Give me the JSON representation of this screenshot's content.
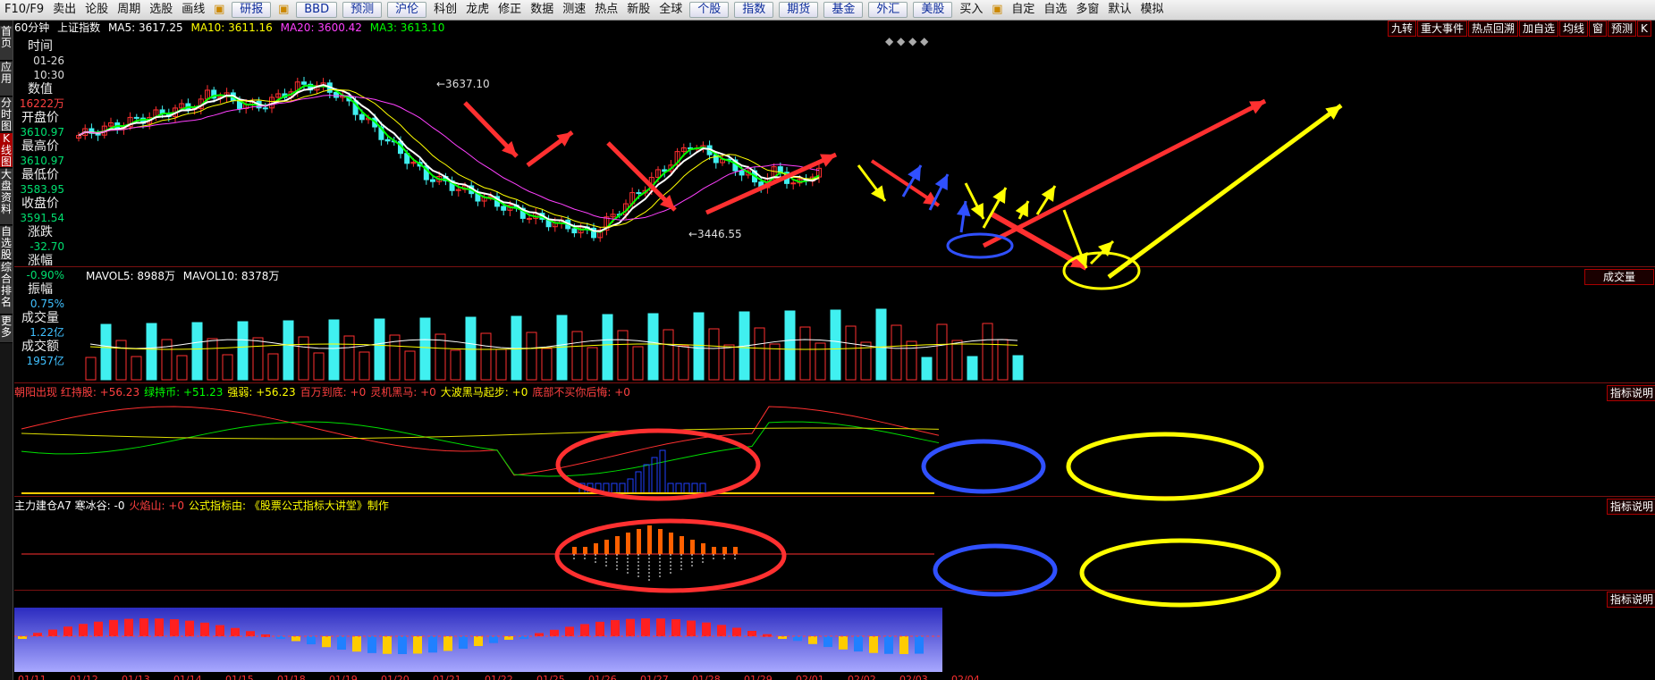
{
  "toolbar": {
    "items": [
      "F10/F9",
      "卖出",
      "论股",
      "周期",
      "选股",
      "画线",
      "",
      "研报",
      "",
      "BBD",
      "预测",
      "沪伦",
      "科创",
      "龙虎",
      "修正",
      "数据",
      "测速",
      "热点",
      "新股",
      "全球",
      "个股",
      "指数",
      "期货",
      "基金",
      "外汇",
      "美股",
      "买入",
      "",
      "自定",
      "自选",
      "多窗",
      "默认",
      "模拟"
    ]
  },
  "leftnav": [
    "首页",
    "应用",
    "分时图",
    "K线图",
    "大盘资料",
    "自选股",
    "综合排名",
    "更多"
  ],
  "chart_header": {
    "period": "60分钟",
    "name": "上证指数",
    "ma5": "MA5: 3617.25",
    "ma10": "MA10: 3611.16",
    "ma20": "MA20: 3600.42",
    "ma3": "MA3: 3613.10"
  },
  "right_buttons": [
    "九转",
    "重大事件",
    "热点回溯",
    "加自选",
    "均线",
    "窗",
    "预测",
    "K"
  ],
  "info_panel": [
    {
      "label": "时间",
      "value": "01-26"
    },
    {
      "label": "",
      "value": "10:30"
    },
    {
      "label": "数值",
      "value": "16222万"
    },
    {
      "label": "开盘价",
      "value": "3610.97"
    },
    {
      "label": "最高价",
      "value": "3610.97"
    },
    {
      "label": "最低价",
      "value": "3583.95"
    },
    {
      "label": "收盘价",
      "value": "3591.54"
    },
    {
      "label": "涨跌",
      "value": "-32.70"
    },
    {
      "label": "涨幅",
      "value": "-0.90%"
    },
    {
      "label": "振幅",
      "value": "0.75%"
    },
    {
      "label": "成交量",
      "value": "1.22亿"
    },
    {
      "label": "成交额",
      "value": "1957亿"
    }
  ],
  "price_labels": {
    "high": "3637.10",
    "low": "3446.55"
  },
  "volume_header": {
    "mavol5": "MAVOL5: 8988万",
    "mavol10": "MAVOL10: 8378万",
    "button": "成交量"
  },
  "ind1_header": {
    "items": [
      "朝阳出现 红持股: +56.23",
      "绿持币: +51.23",
      "强弱: +56.23",
      "百万到底: +0",
      "灵机黑马: +0",
      "大波黑马起步: +0",
      "底部不买你后悔: +0"
    ],
    "button": "指标说明"
  },
  "ind2_header": {
    "items": [
      "主力建仓A7 寒冰谷: -0",
      "火焰山: +0",
      "公式指标由: 《股票公式指标大讲堂》制作"
    ],
    "button": "指标说明"
  },
  "ind3_button": "指标说明",
  "date_labels": [
    "01/11",
    "01/12",
    "01/13",
    "01/14",
    "01/15",
    "01/18",
    "01/19",
    "01/20",
    "01/21",
    "01/22",
    "01/25",
    "01/26",
    "01/27",
    "01/28",
    "01/29",
    "02/01",
    "02/02",
    "02/03",
    "02/04"
  ],
  "colors": {
    "up": "#ff3030",
    "down": "#40f0f0",
    "ma5": "#ffffff",
    "ma10": "#ffff00",
    "ma20": "#ff40ff",
    "ma3": "#00ff00",
    "arrowRed": "#ff3030",
    "arrowYellow": "#ffff00",
    "arrowBlue": "#3050ff"
  }
}
